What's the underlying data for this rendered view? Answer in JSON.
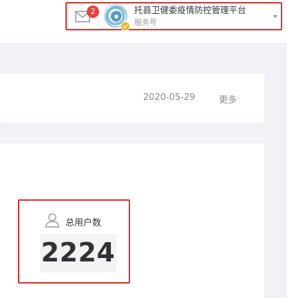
{
  "header": {
    "mail_badge": "2",
    "account_name": "托县卫健委疫情防控管理平台",
    "account_type": "服务号"
  },
  "notice": {
    "date": "2020-05-29",
    "more_label": "更多"
  },
  "stats": {
    "total_users_label": "总用户数",
    "total_users_value": "2224"
  },
  "colors": {
    "highlight_border": "#d9302b",
    "badge": "#e64340",
    "verified_badge": "#f5b22b",
    "background": "#f1f2f5"
  },
  "icons": {
    "mail": "mail-icon",
    "avatar": "account-avatar",
    "verified": "verified-check-icon",
    "dropdown": "caret-down-icon",
    "user": "user-icon"
  }
}
